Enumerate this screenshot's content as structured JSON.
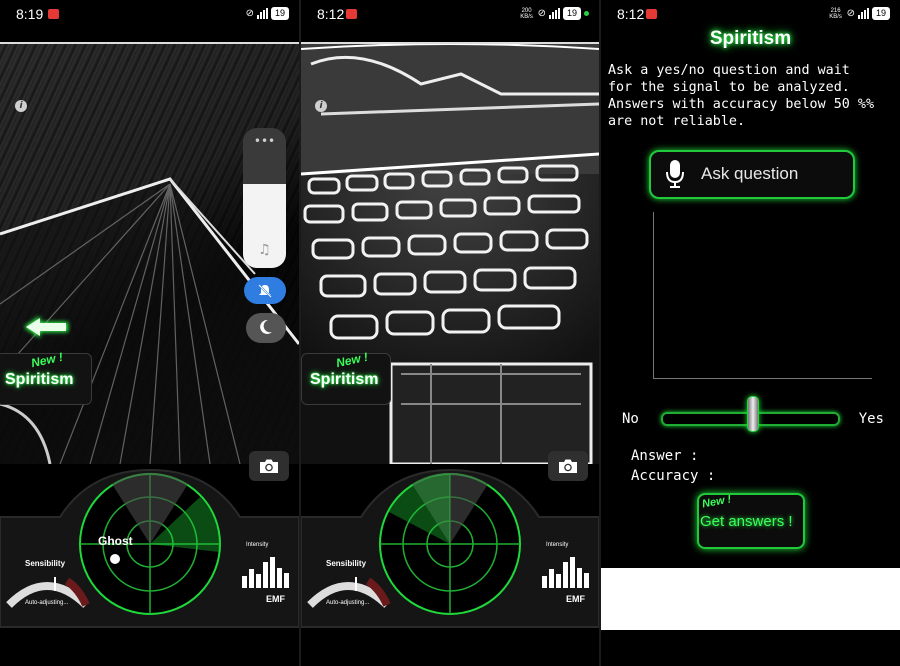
{
  "screens": [
    {
      "status": {
        "time": "8:19",
        "battery": "19"
      },
      "spiritism_button": {
        "label": "Spiritism",
        "badge": "New !"
      },
      "radar": {
        "ghost_label": "Ghost"
      },
      "sensibility": {
        "label": "Sensibility",
        "sub": "Auto-adjusting..."
      },
      "emf": {
        "title": "Intensity",
        "label": "EMF",
        "bars": [
          0.35,
          0.55,
          0.4,
          0.75,
          0.9,
          0.6,
          0.45
        ]
      },
      "volume_panel": {
        "dots": "•••",
        "level": 0.6
      }
    },
    {
      "status": {
        "time": "8:12",
        "speed": "200 KB/s",
        "battery": "19"
      },
      "spiritism_button": {
        "label": "Spiritism",
        "badge": "New !"
      },
      "sensibility": {
        "label": "Sensibility",
        "sub": "Auto-adjusting..."
      },
      "emf": {
        "title": "Intensity",
        "label": "EMF",
        "bars": [
          0.35,
          0.55,
          0.4,
          0.75,
          0.9,
          0.6,
          0.45
        ]
      }
    },
    {
      "status": {
        "time": "8:12",
        "speed": "216 KB/s",
        "battery": "19"
      },
      "title": "Spiritism",
      "instructions": "Ask a yes/no question and wait\nfor the signal to be analyzed.\nAnswers with accuracy below 50 %%\nare not reliable.",
      "ask_button": "Ask question",
      "slider": {
        "no": "No",
        "yes": "Yes",
        "position": 0.52
      },
      "answer_label": "Answer :",
      "accuracy_label": "Accuracy :",
      "get_answers": {
        "label": "Get answers !",
        "badge": "New !"
      }
    }
  ],
  "colors": {
    "neon_green": "#2cff4a",
    "accent_blue": "#2f7de1",
    "background": "#000000"
  }
}
